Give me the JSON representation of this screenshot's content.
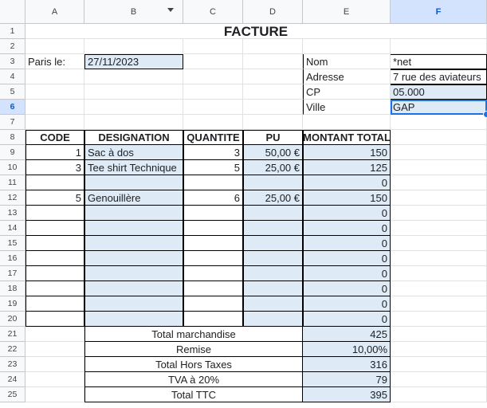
{
  "columns": [
    "A",
    "B",
    "C",
    "D",
    "E",
    "F"
  ],
  "rows": [
    "1",
    "2",
    "3",
    "4",
    "5",
    "6",
    "7",
    "8",
    "9",
    "10",
    "11",
    "12",
    "13",
    "14",
    "15",
    "16",
    "17",
    "18",
    "19",
    "20",
    "21",
    "22",
    "23",
    "24",
    "25"
  ],
  "title": "FACTURE",
  "place_label": "Paris le:",
  "date": "27/11/2023",
  "client": {
    "nom_label": "Nom",
    "nom": "*net",
    "adresse_label": "Adresse",
    "adresse": "7 rue des aviateurs",
    "cp_label": "CP",
    "cp": "05.000",
    "ville_label": "Ville",
    "ville": "GAP"
  },
  "table": {
    "headers": [
      "CODE",
      "DESIGNATION",
      "QUANTITE",
      "PU",
      "MONTANT TOTAL"
    ],
    "rows": [
      {
        "code": "1",
        "designation": "Sac à dos",
        "quantite": "3",
        "pu": "50,00 €",
        "total": "150"
      },
      {
        "code": "3",
        "designation": "Tee shirt Technique",
        "quantite": "5",
        "pu": "25,00 €",
        "total": "125"
      },
      {
        "code": "",
        "designation": "",
        "quantite": "",
        "pu": "",
        "total": "0"
      },
      {
        "code": "5",
        "designation": "Genouillère",
        "quantite": "6",
        "pu": "25,00 €",
        "total": "150"
      },
      {
        "code": "",
        "designation": "",
        "quantite": "",
        "pu": "",
        "total": "0"
      },
      {
        "code": "",
        "designation": "",
        "quantite": "",
        "pu": "",
        "total": "0"
      },
      {
        "code": "",
        "designation": "",
        "quantite": "",
        "pu": "",
        "total": "0"
      },
      {
        "code": "",
        "designation": "",
        "quantite": "",
        "pu": "",
        "total": "0"
      },
      {
        "code": "",
        "designation": "",
        "quantite": "",
        "pu": "",
        "total": "0"
      },
      {
        "code": "",
        "designation": "",
        "quantite": "",
        "pu": "",
        "total": "0"
      },
      {
        "code": "",
        "designation": "",
        "quantite": "",
        "pu": "",
        "total": "0"
      },
      {
        "code": "",
        "designation": "",
        "quantite": "",
        "pu": "",
        "total": "0"
      }
    ]
  },
  "summary": [
    {
      "label": "Total marchandise",
      "value": "425"
    },
    {
      "label": "Remise",
      "value": "10,00%"
    },
    {
      "label": "Total Hors Taxes",
      "value": "316"
    },
    {
      "label": "TVA à 20%",
      "value": "79"
    },
    {
      "label": "Total TTC",
      "value": "395"
    }
  ],
  "selected_cell": "F6",
  "colors": {
    "fill": "#deebf7",
    "selection": "#1a73e8"
  }
}
